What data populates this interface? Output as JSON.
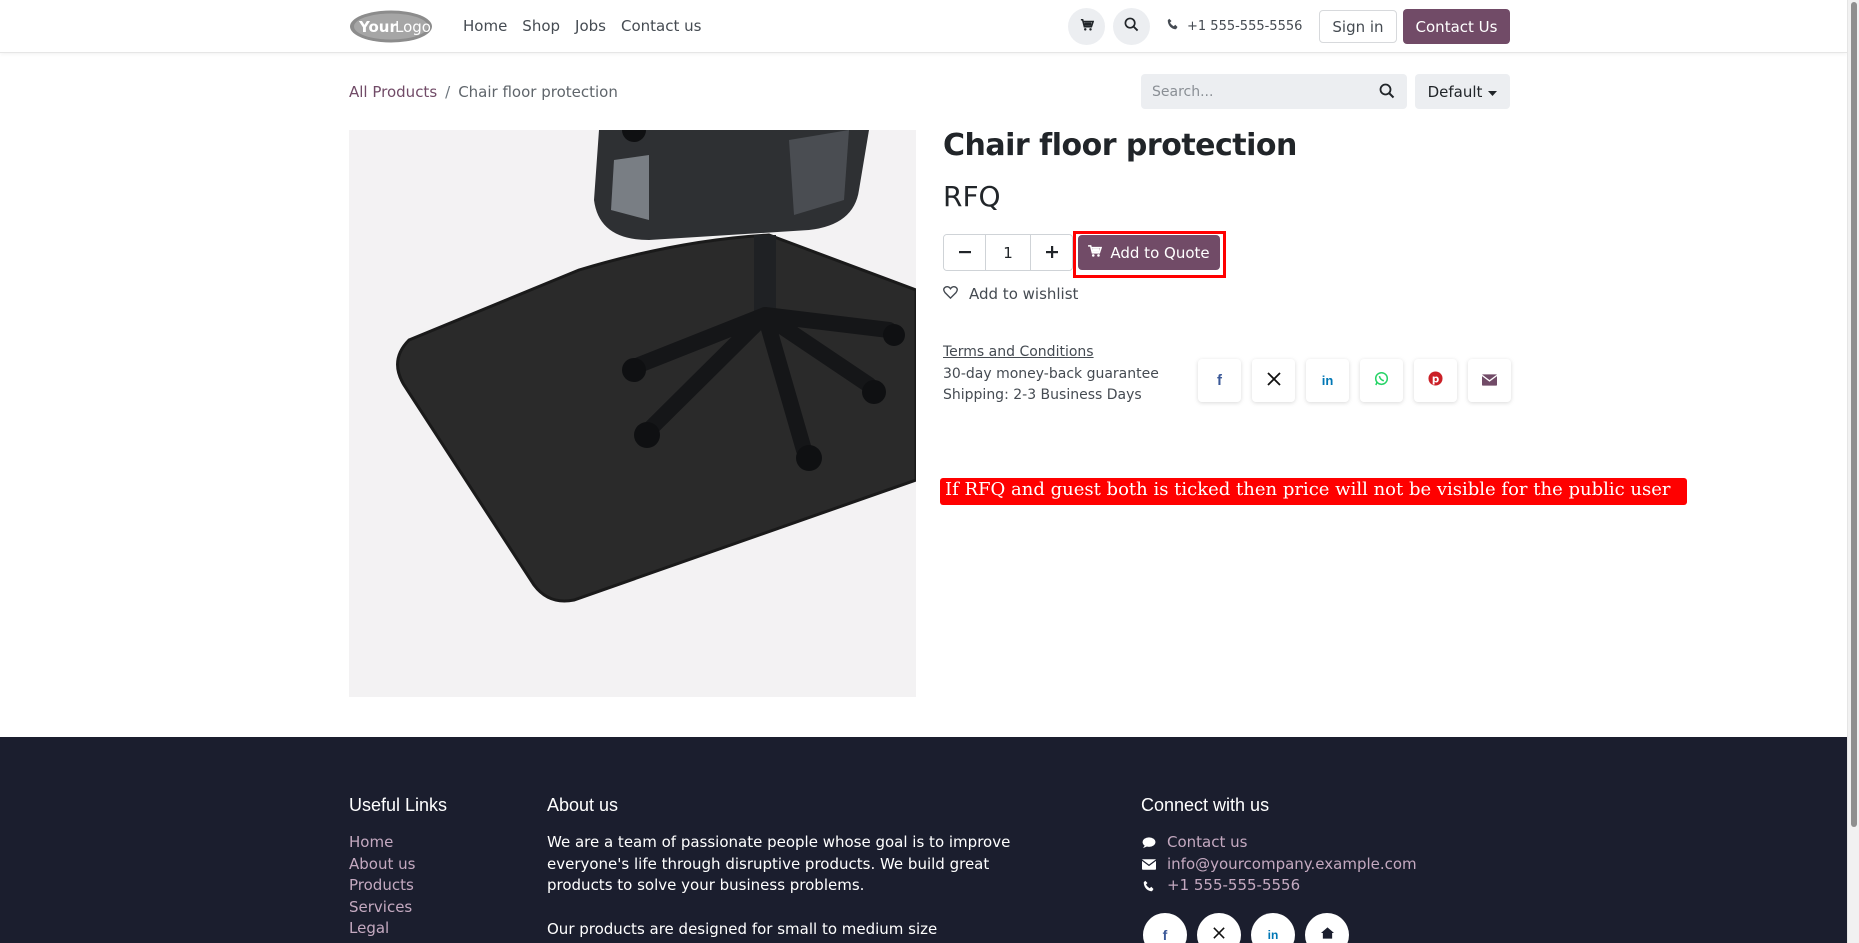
{
  "header": {
    "logo_text": "YourLogo",
    "nav": [
      "Home",
      "Shop",
      "Jobs",
      "Contact us"
    ],
    "phone": "+1 555-555-5556",
    "sign_in": "Sign in",
    "contact_us": "Contact Us"
  },
  "breadcrumb": {
    "root": "All Products",
    "separator": "/",
    "current": "Chair floor protection"
  },
  "search": {
    "placeholder": "Search...",
    "sort_label": "Default"
  },
  "product": {
    "title": "Chair floor protection",
    "price": "RFQ",
    "quantity": "1",
    "add_button": "Add to Quote",
    "wishlist": "Add to wishlist",
    "terms_link": "Terms and Conditions",
    "guarantee": "30-day money-back guarantee",
    "shipping": "Shipping: 2-3 Business Days",
    "share_icons": [
      "facebook-icon",
      "x-icon",
      "linkedin-icon",
      "whatsapp-icon",
      "pinterest-icon",
      "email-icon"
    ]
  },
  "annotation": {
    "note": "If RFQ and guest both is ticked then price will not be visible for the public user"
  },
  "footer": {
    "useful_links_title": "Useful Links",
    "useful_links": [
      "Home",
      "About us",
      "Products",
      "Services",
      "Legal"
    ],
    "about_title": "About us",
    "about_p1": "We are a team of passionate people whose goal is to improve everyone's life through disruptive products. We build great products to solve your business problems.",
    "about_p2": "Our products are designed for small to medium size companies",
    "connect_title": "Connect with us",
    "connect_contact": "Contact us",
    "connect_email": "info@yourcompany.example.com",
    "connect_phone": "+1 555-555-5556"
  },
  "colors": {
    "brand": "#714b67",
    "footer_bg": "#1b1e2e",
    "annotation_red": "#ff0000"
  }
}
